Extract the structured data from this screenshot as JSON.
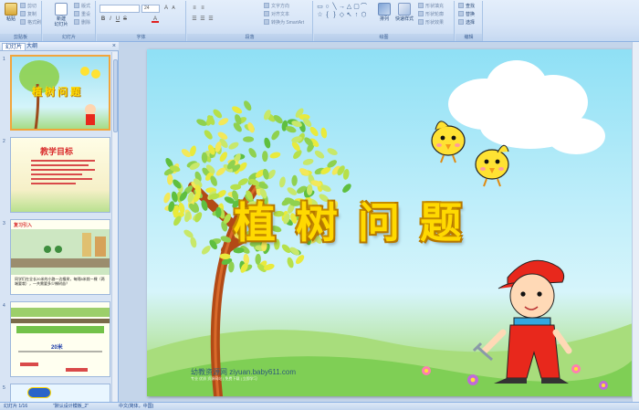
{
  "ribbon": {
    "clipboard": {
      "paste": "粘贴",
      "cut": "剪切",
      "copy": "复制",
      "format_painter": "格式刷",
      "label": "剪贴板"
    },
    "slides": {
      "new_slide": "新建\n幻灯片",
      "layout": "版式",
      "reset": "重设",
      "delete": "删除",
      "label": "幻灯片"
    },
    "font": {
      "size": "24",
      "label": "字体"
    },
    "paragraph": {
      "text_direction": "文字方向",
      "align_text": "对齐文本",
      "smartart": "转换为 SmartArt",
      "label": "段落"
    },
    "drawing": {
      "arrange": "排列",
      "quick_styles": "快速样式",
      "shape_fill": "形状填充",
      "shape_outline": "形状轮廓",
      "shape_effects": "形状效果",
      "label": "绘图"
    },
    "editing": {
      "find": "查找",
      "replace": "替换",
      "select": "选择",
      "label": "编辑"
    }
  },
  "panel": {
    "tab_slides": "幻灯片",
    "tab_outline": "大纲",
    "close": "×",
    "thumbs": [
      {
        "num": "1",
        "title": "植树问题"
      },
      {
        "num": "2",
        "title": "教学目标"
      },
      {
        "num": "3",
        "title": "复习引入",
        "caption": "同学们在全长20米的小路一边植树，每隔5米栽一棵（两端要栽），一共需要多少棵树苗？"
      },
      {
        "num": "4",
        "label": "20米"
      },
      {
        "num": "5"
      }
    ]
  },
  "slide": {
    "title": "植树问题",
    "watermark": "幼教资源网 ziyuan.baby611.com",
    "watermark_sub": "专业 优质 资源网站 | 免费下载 | 立即学习"
  },
  "status": {
    "slide_index": "幻灯片 1/16",
    "theme": "\"默认设计模板_2\"",
    "language": "中文(简体，中国)"
  },
  "colors": {
    "title_fill": "#ffd900",
    "title_stroke": "#b57700",
    "sky": "#8fe0f5",
    "grass": "#8fd36a",
    "active_thumb_border": "#f2a53b"
  }
}
